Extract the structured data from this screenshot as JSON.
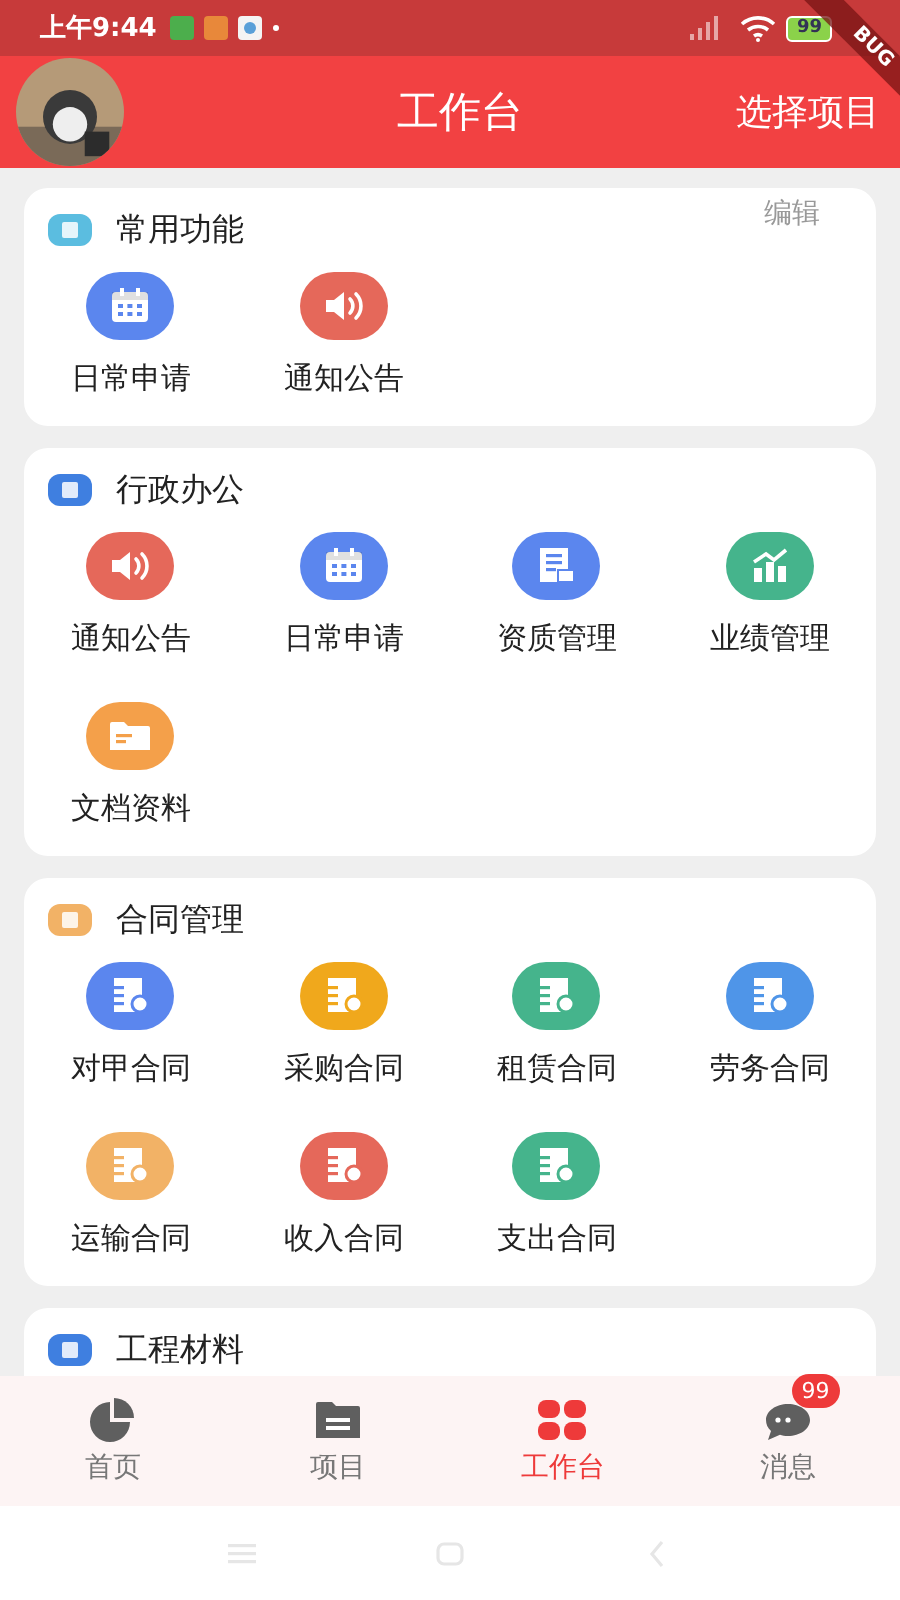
{
  "status_bar": {
    "time": "上午9:44",
    "battery": "99"
  },
  "debug_ribbon": "BUG",
  "header": {
    "title": "工作台",
    "action": "选择项目"
  },
  "sections": [
    {
      "title": "常用功能",
      "color": "#5bbde0",
      "edit": "编辑",
      "items": [
        {
          "label": "日常申请",
          "kind": "calendar",
          "color": "#5b86ee"
        },
        {
          "label": "通知公告",
          "kind": "speaker",
          "color": "#e5685a"
        }
      ]
    },
    {
      "title": "行政办公",
      "color": "#3f7fe0",
      "items": [
        {
          "label": "通知公告",
          "kind": "speaker",
          "color": "#e5685a"
        },
        {
          "label": "日常申请",
          "kind": "calendar",
          "color": "#5b86ee"
        },
        {
          "label": "资质管理",
          "kind": "certificate",
          "color": "#5b86ee"
        },
        {
          "label": "业绩管理",
          "kind": "chart",
          "color": "#45b48c"
        },
        {
          "label": "文档资料",
          "kind": "folder",
          "color": "#f4a04a"
        }
      ]
    },
    {
      "title": "合同管理",
      "color": "#f2b266",
      "items": [
        {
          "label": "对甲合同",
          "kind": "contract",
          "color": "#5b86ee"
        },
        {
          "label": "采购合同",
          "kind": "contract",
          "color": "#f0a81c"
        },
        {
          "label": "租赁合同",
          "kind": "contract",
          "color": "#45b48c"
        },
        {
          "label": "劳务合同",
          "kind": "contract",
          "color": "#4f95e8"
        },
        {
          "label": "运输合同",
          "kind": "contract",
          "color": "#f2b266"
        },
        {
          "label": "收入合同",
          "kind": "contract",
          "color": "#e5685a"
        },
        {
          "label": "支出合同",
          "kind": "contract",
          "color": "#45b48c"
        }
      ]
    },
    {
      "title": "工程材料",
      "color": "#3f7fe0"
    }
  ],
  "tabs": [
    {
      "label": "首页",
      "kind": "pie",
      "selected": false
    },
    {
      "label": "项目",
      "kind": "folder",
      "selected": false
    },
    {
      "label": "工作台",
      "kind": "grid",
      "selected": true
    },
    {
      "label": "消息",
      "kind": "chat",
      "selected": false,
      "badge": "99"
    }
  ]
}
